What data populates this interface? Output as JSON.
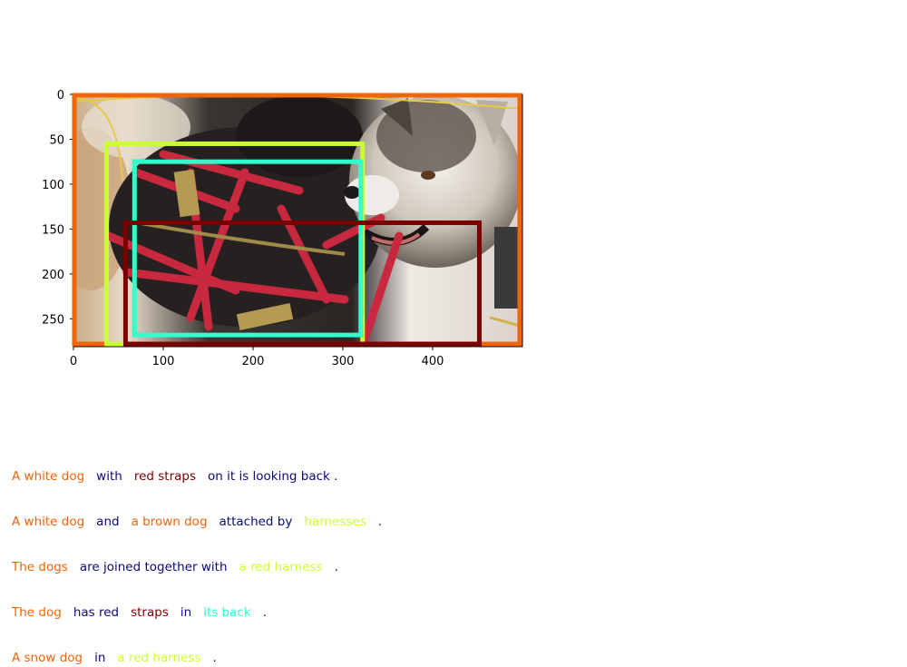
{
  "image_size": {
    "width": 500,
    "height": 281
  },
  "axes": {
    "x_ticks": [
      0,
      100,
      200,
      300,
      400
    ],
    "y_ticks": [
      0,
      50,
      100,
      150,
      200,
      250
    ]
  },
  "colors": {
    "orange": "#f0640a",
    "navy": "#0a0a7a",
    "maroon": "#7a0000",
    "lime": "#ccff33",
    "aqua": "#33ffcc"
  },
  "boxes": [
    {
      "label": "A white dog",
      "color": "#f0640a",
      "x0": 1,
      "y0": 1,
      "x1": 497,
      "y1": 278
    },
    {
      "label": "a red harness",
      "color": "#ccff33",
      "x0": 37,
      "y0": 55,
      "x1": 322,
      "y1": 278
    },
    {
      "label": "its back",
      "color": "#33ffcc",
      "x0": 68,
      "y0": 75,
      "x1": 320,
      "y1": 268
    },
    {
      "label": "red straps",
      "color": "#7a0000",
      "x0": 58,
      "y0": 143,
      "x1": 452,
      "y1": 278
    }
  ],
  "captions": [
    [
      {
        "text": "A white dog",
        "color": "#f0640a"
      },
      {
        "text": "with",
        "color": "#0a0a7a"
      },
      {
        "text": "red straps",
        "color": "#7a0000"
      },
      {
        "text": "on it is looking back .",
        "color": "#0a0a7a"
      }
    ],
    [
      {
        "text": "A white dog",
        "color": "#f0640a"
      },
      {
        "text": "and",
        "color": "#0a0a7a"
      },
      {
        "text": "a brown dog",
        "color": "#f0640a"
      },
      {
        "text": "attached by",
        "color": "#0a0a7a"
      },
      {
        "text": "harnesses",
        "color": "#ccff33"
      },
      {
        "text": ".",
        "color": "#0a0a7a"
      }
    ],
    [
      {
        "text": "The dogs",
        "color": "#f0640a"
      },
      {
        "text": "are joined together with",
        "color": "#0a0a7a"
      },
      {
        "text": "a red harness",
        "color": "#ccff33"
      },
      {
        "text": ".",
        "color": "#0a0a7a"
      }
    ],
    [
      {
        "text": "The dog",
        "color": "#f0640a"
      },
      {
        "text": "has red",
        "color": "#0a0a7a"
      },
      {
        "text": "straps",
        "color": "#7a0000"
      },
      {
        "text": "in",
        "color": "#0a0a7a"
      },
      {
        "text": "its back",
        "color": "#33ffcc"
      },
      {
        "text": ".",
        "color": "#0a0a7a"
      }
    ],
    [
      {
        "text": "A snow dog",
        "color": "#f0640a"
      },
      {
        "text": "in",
        "color": "#0a0a7a"
      },
      {
        "text": "a red harness",
        "color": "#ccff33"
      },
      {
        "text": ".",
        "color": "#0a0a7a"
      }
    ]
  ]
}
